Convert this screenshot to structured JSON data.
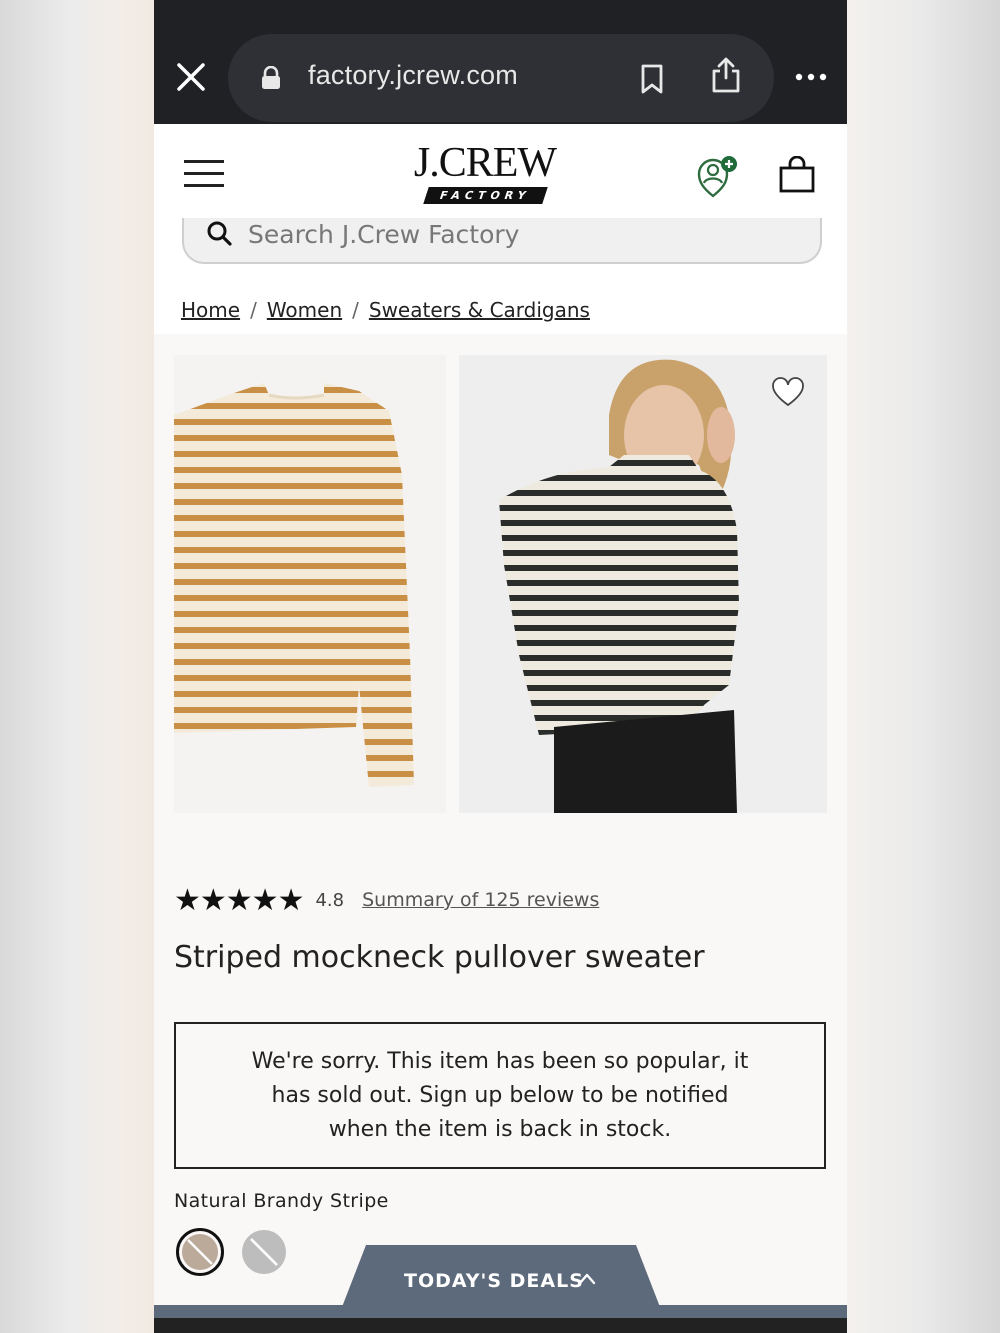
{
  "browser": {
    "url": "factory.jcrew.com"
  },
  "header": {
    "logo_main": "J.CREW",
    "logo_sub": "FACTORY"
  },
  "search": {
    "placeholder": "Search J.Crew Factory"
  },
  "breadcrumb": [
    "Home",
    "Women",
    "Sweaters & Cardigans"
  ],
  "product": {
    "stars": "★★★★★",
    "rating": "4.8",
    "reviews_link": "Summary of 125 reviews",
    "title": "Striped mockneck pullover sweater",
    "sold_out_message": "We're sorry. This item has been so popular, it has sold out. Sign up below to be notified when the item is back in stock.",
    "color_name": "Natural Brandy Stripe",
    "swatches": [
      "Natural Brandy Stripe",
      "grey stripe"
    ]
  },
  "deals": {
    "label": "TODAY'S DEALS"
  },
  "colors": {
    "browser_bg": "#1f2125",
    "deals_tab": "#5d6a7b",
    "text": "#222222"
  }
}
